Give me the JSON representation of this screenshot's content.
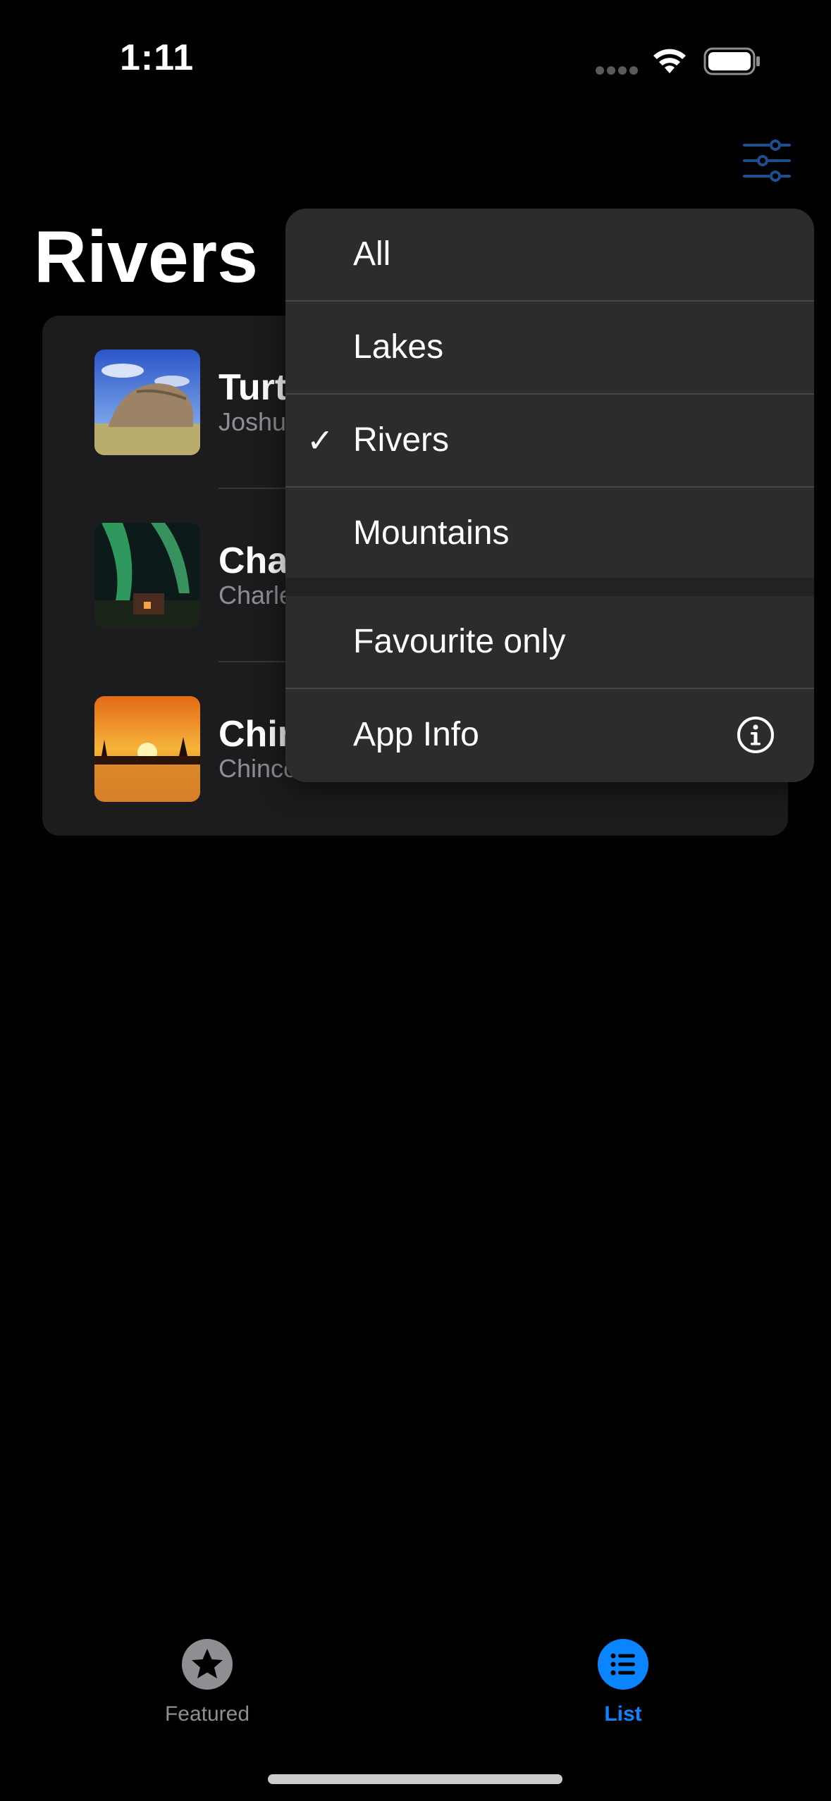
{
  "status_bar": {
    "time": "1:11"
  },
  "page": {
    "title": "Rivers"
  },
  "list": {
    "items": [
      {
        "title": "Turt",
        "subtitle": "Joshu"
      },
      {
        "title": "Cha",
        "subtitle": "Charle"
      },
      {
        "title": "Chir",
        "subtitle": "Chinco"
      }
    ]
  },
  "filter_menu": {
    "items": [
      {
        "label": "All",
        "checked": false
      },
      {
        "label": "Lakes",
        "checked": false
      },
      {
        "label": "Rivers",
        "checked": true
      },
      {
        "label": "Mountains",
        "checked": false
      },
      {
        "label": "Favourite only",
        "checked": false
      },
      {
        "label": "App Info",
        "checked": false,
        "icon": "info-icon"
      }
    ],
    "check_glyph": "✓"
  },
  "tab_bar": {
    "tabs": [
      {
        "label": "Featured",
        "icon": "star-icon",
        "selected": false
      },
      {
        "label": "List",
        "icon": "list-icon",
        "selected": true
      }
    ]
  },
  "colors": {
    "accent": "#0a84ff",
    "filter_icon": "#1f4e8f",
    "inactive_tab": "#8e8e93"
  }
}
